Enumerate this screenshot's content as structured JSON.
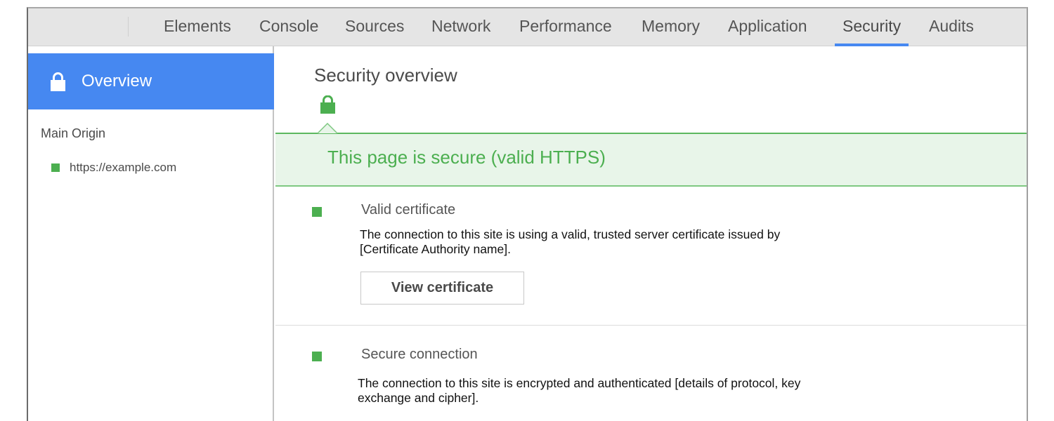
{
  "tabs": [
    {
      "label": "Elements",
      "active": false
    },
    {
      "label": "Console",
      "active": false
    },
    {
      "label": "Sources",
      "active": false
    },
    {
      "label": "Network",
      "active": false
    },
    {
      "label": "Performance",
      "active": false
    },
    {
      "label": "Memory",
      "active": false
    },
    {
      "label": "Application",
      "active": false
    },
    {
      "label": "Security",
      "active": true
    },
    {
      "label": "Audits",
      "active": false
    }
  ],
  "sidebar": {
    "overview": {
      "label": "Overview",
      "icon": "lock-icon",
      "selected": true
    },
    "main_origin_label": "Main Origin",
    "origins": [
      {
        "url": "https://example.com",
        "status": "secure",
        "status_color": "#4caf50"
      }
    ]
  },
  "main": {
    "title": "Security overview",
    "status_icon": "lock-icon",
    "banner_text": "This page is secure (valid HTTPS)",
    "sections": [
      {
        "heading": "Valid certificate",
        "description": "The connection to this site is using a valid, trusted server certificate issued by [Certificate Authority name].",
        "button_label": "View certificate",
        "status_color": "#4caf50"
      },
      {
        "heading": "Secure connection",
        "description": "The connection to this site is encrypted and authenticated [details of protocol, key exchange and cipher].",
        "status_color": "#4caf50"
      }
    ]
  },
  "colors": {
    "accent": "#4688f1",
    "secure_green": "#4caf50",
    "banner_bg": "#e8f5e9",
    "tabbar_bg": "#e5e5e5"
  }
}
